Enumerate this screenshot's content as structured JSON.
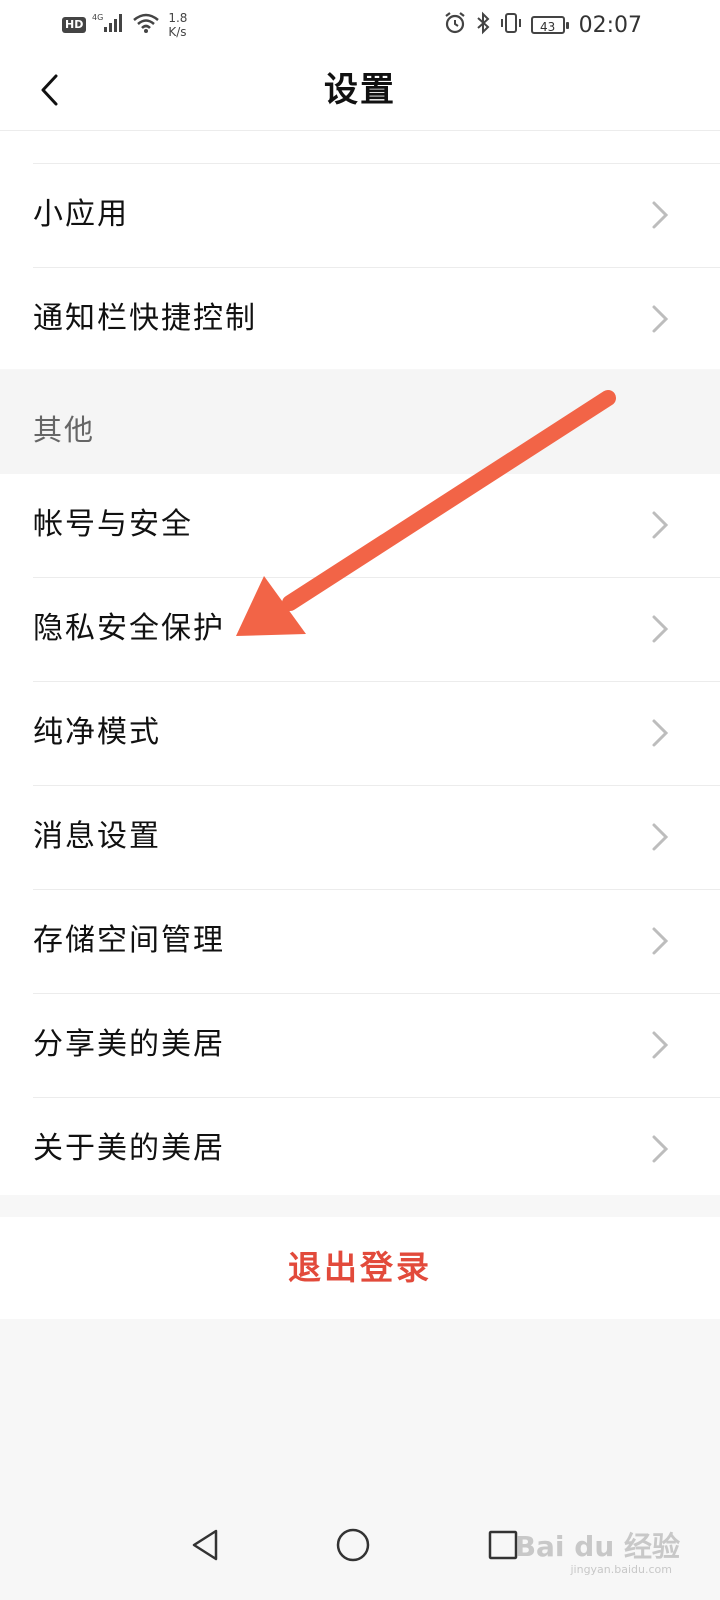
{
  "status_bar": {
    "hd": "HD",
    "network": "4G",
    "speed_value": "1.8",
    "speed_unit": "K/s",
    "battery": "43",
    "time": "02:07"
  },
  "header": {
    "title": "设置"
  },
  "top_section": {
    "items": [
      {
        "label": "小应用"
      },
      {
        "label": "通知栏快捷控制"
      }
    ]
  },
  "other_section": {
    "header": "其他",
    "items": [
      {
        "label": "帐号与安全"
      },
      {
        "label": "隐私安全保护"
      },
      {
        "label": "纯净模式"
      },
      {
        "label": "消息设置"
      },
      {
        "label": "存储空间管理"
      },
      {
        "label": "分享美的美居"
      },
      {
        "label": "关于美的美居"
      }
    ]
  },
  "logout": {
    "label": "退出登录"
  },
  "colors": {
    "annotation_arrow": "#f26447",
    "logout": "#e24a3b"
  },
  "watermark": {
    "brand": "Bai du 经验",
    "url": "jingyan.baidu.com"
  }
}
